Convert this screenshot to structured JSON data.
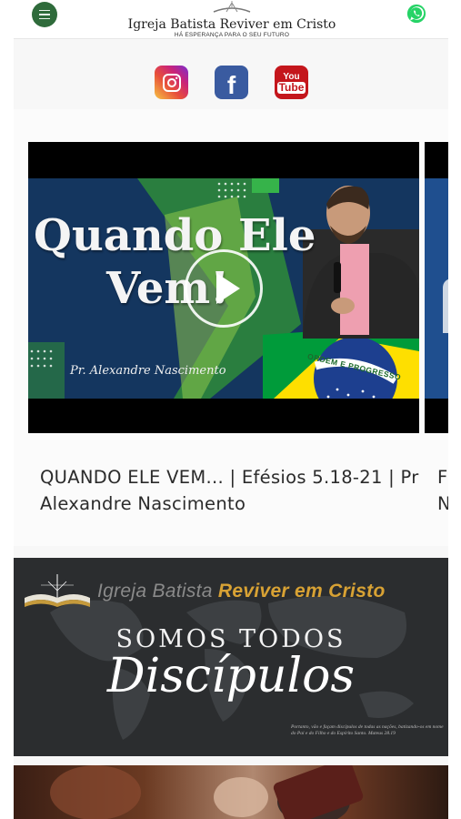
{
  "header": {
    "title": "Igreja Batista Reviver em Cristo",
    "subtitle": "HÁ ESPERANÇA PARA O SEU FUTURO",
    "menu_icon": "hamburger-icon",
    "whatsapp_icon": "whatsapp-icon",
    "brand_color": "#2f6b3b"
  },
  "social": [
    {
      "name": "instagram-icon",
      "color": "#c9237a"
    },
    {
      "name": "facebook-icon",
      "label": "f",
      "color": "#3a5ba0"
    },
    {
      "name": "youtube-icon",
      "label_top": "You",
      "label_bottom": "Tube",
      "color": "#c4161c"
    }
  ],
  "video": {
    "thumb_title_line1": "Quando Ele",
    "thumb_title_line2": "Vem!",
    "thumb_subtitle": "Pr. Alexandre Nascimento",
    "flag_motto": "ORDEM E PROGRESSO",
    "title": "QUANDO ELE VEM... | Efésios 5.18-21 | Pr Alexandre Nascimento",
    "next_title_fragment": "F N"
  },
  "banner": {
    "brand_left": "Igreja Batista",
    "brand_right": "Reviver em Cristo",
    "headline": "SOMOS TODOS",
    "script": "Discípulos",
    "verse": "Portanto, vão e façam discípulos de todas as nações, batizando-os em nome do Pai e do Filho e do Espírito Santo. Mateus 28.19",
    "accent": "#d8a234"
  }
}
